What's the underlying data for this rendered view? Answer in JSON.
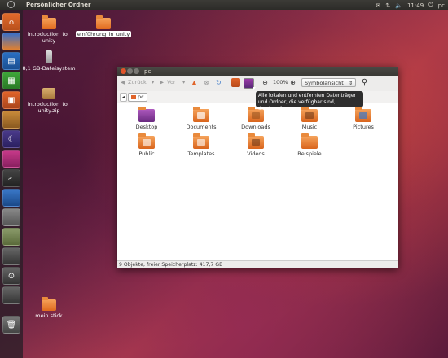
{
  "top_panel": {
    "title": "Persönlicher Ordner",
    "clock": "11:49",
    "user": "pc",
    "tray_icons": [
      "mail-icon",
      "network-icon",
      "volume-icon",
      "power-icon"
    ]
  },
  "launcher": {
    "items": [
      "home-folder-icon",
      "firefox-icon",
      "writer-icon",
      "calc-icon",
      "impress-icon",
      "software-center-icon",
      "ubuntu-one-icon",
      "workspaces-icon",
      "terminal-icon",
      "thunderbird-icon",
      "screenshot-icon",
      "system-settings-icon",
      "screen-icon",
      "lens-icon",
      "search-lens-icon",
      "trash-icon"
    ]
  },
  "desktop": {
    "icons": [
      {
        "label": "introduction_to_\nunity",
        "type": "folder"
      },
      {
        "label": "einführung_in_unity",
        "type": "folder",
        "selected": true
      },
      {
        "label": "8,1 GB-Dateisystem",
        "type": "usb"
      },
      {
        "label": "introduction_to_\nunity.zip",
        "type": "zip"
      },
      {
        "label": "mein stick",
        "type": "folder"
      }
    ]
  },
  "window": {
    "title": "pc",
    "toolbar": {
      "back": "Zurück",
      "forward": "Vor",
      "zoom": "100%",
      "view": "Symbolansicht"
    },
    "breadcrumb": "pc",
    "files": [
      "Desktop",
      "Documents",
      "Downloads",
      "Music",
      "Pictures",
      "Public",
      "Templates",
      "Videos",
      "Beispiele"
    ],
    "status": "9 Objekte, freier Speicherplatz: 417,7 GB",
    "tooltip": "Alle lokalen und entfernten Datenträger und Ordner, die verfügbar sind, durchsuchen"
  }
}
